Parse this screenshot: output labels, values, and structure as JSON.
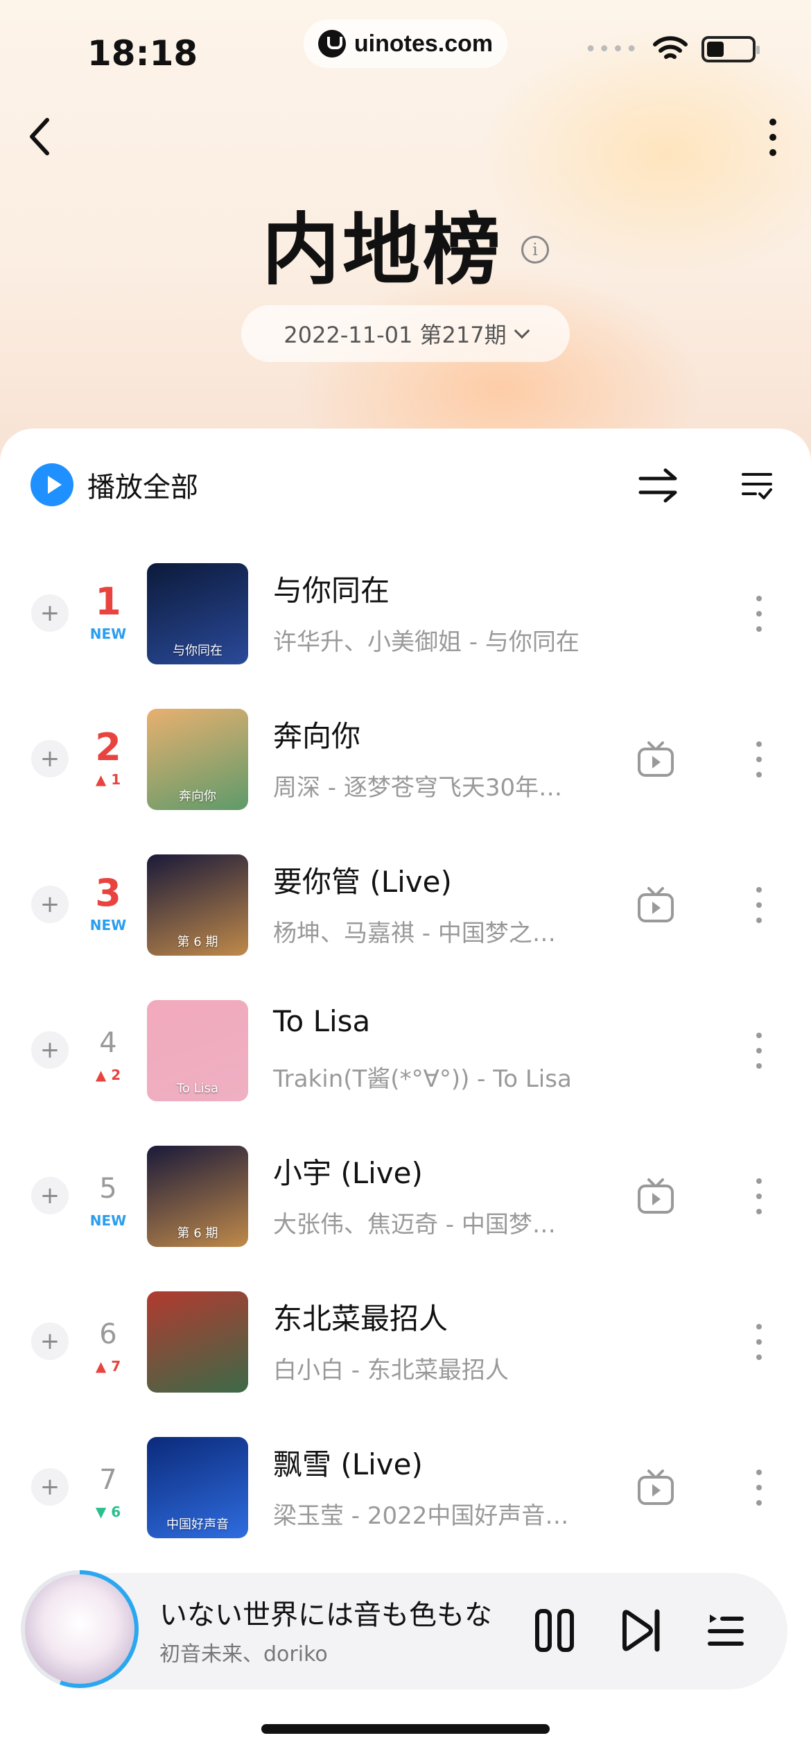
{
  "status_bar": {
    "time": "18:18",
    "url": "uinotes.com",
    "signal_dots": "••••"
  },
  "header": {
    "title": "内地榜",
    "issue": "2022-11-01 第217期"
  },
  "toolbar": {
    "play_all_label": "播放全部"
  },
  "songs": [
    {
      "rank": "1",
      "change": "NEW",
      "change_type": "new",
      "top": true,
      "title": "与你同在",
      "subtitle": "许华升、小美御姐 - 与你同在",
      "has_mv": false,
      "cover_colors": [
        "#0c1a3a",
        "#2a4a9a"
      ],
      "cover_text": "与你同在"
    },
    {
      "rank": "2",
      "change": "▲ 1",
      "change_type": "up",
      "top": true,
      "title": "奔向你",
      "subtitle": "周深 - 逐梦苍穹飞天30年…",
      "has_mv": true,
      "cover_colors": [
        "#e8b070",
        "#5e9a6a"
      ],
      "cover_text": "奔向你"
    },
    {
      "rank": "3",
      "change": "NEW",
      "change_type": "new",
      "top": true,
      "title": "要你管 (Live)",
      "subtitle": "杨坤、马嘉祺 - 中国梦之…",
      "has_mv": true,
      "cover_colors": [
        "#1a1a3a",
        "#c08a4a"
      ],
      "cover_text": "第 6 期"
    },
    {
      "rank": "4",
      "change": "▲ 2",
      "change_type": "up",
      "top": false,
      "title": "To Lisa",
      "subtitle": "Trakin(T酱(*°∀°)) - To Lisa",
      "has_mv": false,
      "cover_colors": [
        "#f2a9bd",
        "#eeb0c2"
      ],
      "cover_text": "To Lisa"
    },
    {
      "rank": "5",
      "change": "NEW",
      "change_type": "new",
      "top": false,
      "title": "小宇 (Live)",
      "subtitle": "大张伟、焦迈奇 - 中国梦…",
      "has_mv": true,
      "cover_colors": [
        "#1a1a3a",
        "#c08a4a"
      ],
      "cover_text": "第 6 期"
    },
    {
      "rank": "6",
      "change": "▲ 7",
      "change_type": "up",
      "top": false,
      "title": "东北菜最招人",
      "subtitle": "白小白 - 东北菜最招人",
      "has_mv": false,
      "cover_colors": [
        "#b23a30",
        "#3c6a48"
      ],
      "cover_text": ""
    },
    {
      "rank": "7",
      "change": "▼ 6",
      "change_type": "down",
      "top": false,
      "title": "飘雪 (Live)",
      "subtitle": "梁玉莹 - 2022中国好声音…",
      "has_mv": true,
      "cover_colors": [
        "#0b2a7a",
        "#2f6de0"
      ],
      "cover_text": "中国好声音"
    }
  ],
  "now_playing": {
    "title": "いない世界には音も色もな",
    "artist": "初音未来、doriko"
  },
  "colors": {
    "accent": "#1e90ff",
    "rank_top": "#e8433f",
    "new_badge": "#2b9ef0",
    "down": "#2bbf8d"
  }
}
